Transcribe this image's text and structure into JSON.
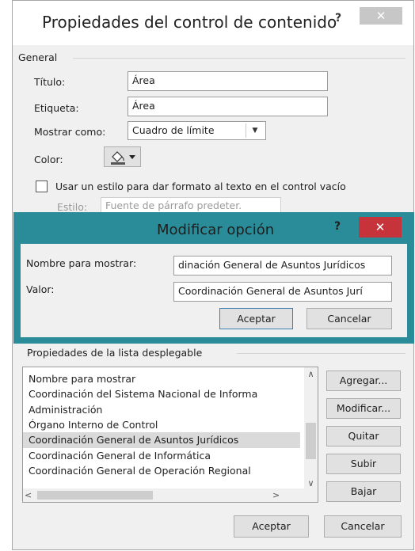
{
  "window": {
    "title": "Propiedades del control de contenido",
    "help": "?",
    "close": "✕"
  },
  "general": {
    "heading": "General",
    "titulo_label": "Título:",
    "titulo_value": "Área",
    "etiqueta_label": "Etiqueta:",
    "etiqueta_value": "Área",
    "mostrar_label": "Mostrar como:",
    "mostrar_value": "Cuadro de límite",
    "color_label": "Color:",
    "usar_estilo_label": "Usar un estilo para dar formato al texto en el control vacío",
    "estilo_label": "Estilo:",
    "estilo_value": "Fuente de párrafo predeter."
  },
  "subdialog": {
    "title": "Modificar opción",
    "help": "?",
    "close": "✕",
    "nombre_label": "Nombre para mostrar:",
    "nombre_value": "dinación General de Asuntos Jurídicos",
    "valor_label": "Valor:",
    "valor_value": "Coordinación General de Asuntos Jurí",
    "accept": "Aceptar",
    "cancel": "Cancelar"
  },
  "dropdown_props": {
    "heading": "Propiedades de la lista desplegable",
    "items": [
      "Nombre para mostrar",
      "Coordinación del Sistema Nacional de Informa",
      "Administración",
      "Órgano Interno de Control",
      "Coordinación General de Asuntos Jurídicos",
      "Coordinación General de Informática",
      "Coordinación General de Operación Regional"
    ],
    "selected_index": 4,
    "buttons": {
      "add": "Agregar...",
      "modify": "Modificar...",
      "remove": "Quitar",
      "up": "Subir",
      "down": "Bajar"
    }
  },
  "footer": {
    "accept": "Aceptar",
    "cancel": "Cancelar"
  }
}
